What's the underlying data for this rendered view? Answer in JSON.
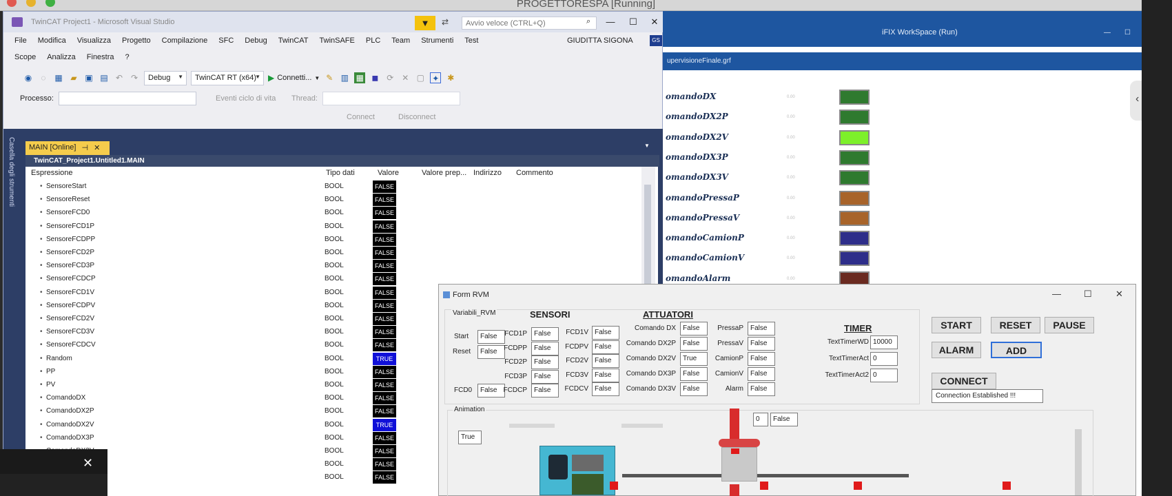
{
  "screen": {
    "title": "PROGETTORESPA [Running]"
  },
  "vs": {
    "title": "TwinCAT Project1 - Microsoft Visual Studio",
    "quick_launch_placeholder": "Avvio veloce (CTRL+Q)",
    "menu_row1": [
      "File",
      "Modifica",
      "Visualizza",
      "Progetto",
      "Compilazione",
      "SFC",
      "Debug",
      "TwinCAT",
      "TwinSAFE",
      "PLC",
      "Team",
      "Strumenti",
      "Test"
    ],
    "menu_row2": [
      "Scope",
      "Analizza",
      "Finestra",
      "?"
    ],
    "user_name": "GIUDITTA SIGONA",
    "user_badge": "GS",
    "toolbar": {
      "config": "Debug",
      "platform": "TwinCAT RT (x64)",
      "connect": "Connetti..."
    },
    "toolbar2": {
      "process_label": "Processo:",
      "events_label": "Eventi ciclo di vita",
      "thread_label": "Thread:"
    },
    "toolbar3": {
      "connect": "Connect",
      "disconnect": "Disconnect"
    },
    "left_strip_label": "Casella degli strumenti",
    "doc_tab": {
      "label": "MAIN [Online]",
      "close": "✕"
    },
    "doc_header": "TwinCAT_Project1.Untitled1.MAIN",
    "columns": {
      "expr": "Espressione",
      "type": "Tipo dati",
      "value": "Valore",
      "prep": "Valore prep...",
      "addr": "Indirizzo",
      "comment": "Commento"
    },
    "variables": [
      {
        "name": "SensoreStart",
        "type": "BOOL",
        "value": "FALSE"
      },
      {
        "name": "SensoreReset",
        "type": "BOOL",
        "value": "FALSE"
      },
      {
        "name": "SensoreFCD0",
        "type": "BOOL",
        "value": "FALSE"
      },
      {
        "name": "SensoreFCD1P",
        "type": "BOOL",
        "value": "FALSE"
      },
      {
        "name": "SensoreFCDPP",
        "type": "BOOL",
        "value": "FALSE"
      },
      {
        "name": "SensoreFCD2P",
        "type": "BOOL",
        "value": "FALSE"
      },
      {
        "name": "SensoreFCD3P",
        "type": "BOOL",
        "value": "FALSE"
      },
      {
        "name": "SensoreFCDCP",
        "type": "BOOL",
        "value": "FALSE"
      },
      {
        "name": "SensoreFCD1V",
        "type": "BOOL",
        "value": "FALSE"
      },
      {
        "name": "SensoreFCDPV",
        "type": "BOOL",
        "value": "FALSE"
      },
      {
        "name": "SensoreFCD2V",
        "type": "BOOL",
        "value": "FALSE"
      },
      {
        "name": "SensoreFCD3V",
        "type": "BOOL",
        "value": "FALSE"
      },
      {
        "name": "SensoreFCDCV",
        "type": "BOOL",
        "value": "FALSE"
      },
      {
        "name": "Random",
        "type": "BOOL",
        "value": "TRUE"
      },
      {
        "name": "PP",
        "type": "BOOL",
        "value": "FALSE"
      },
      {
        "name": "PV",
        "type": "BOOL",
        "value": "FALSE"
      },
      {
        "name": "ComandoDX",
        "type": "BOOL",
        "value": "FALSE"
      },
      {
        "name": "ComandoDX2P",
        "type": "BOOL",
        "value": "FALSE"
      },
      {
        "name": "ComandoDX2V",
        "type": "BOOL",
        "value": "TRUE"
      },
      {
        "name": "ComandoDX3P",
        "type": "BOOL",
        "value": "FALSE"
      },
      {
        "name": "ComandoDX3V",
        "type": "BOOL",
        "value": "FALSE"
      },
      {
        "name": "",
        "type": "BOOL",
        "value": "FALSE"
      },
      {
        "name": "",
        "type": "BOOL",
        "value": "FALSE"
      }
    ]
  },
  "ifix": {
    "title": "iFIX WorkSpace (Run)",
    "tab": "upervisioneFinale.grf",
    "commands": [
      {
        "name": "omandoDX",
        "value": "0.00",
        "color": "#2f7a2f"
      },
      {
        "name": "omandoDX2P",
        "value": "0.00",
        "color": "#2f7a2f"
      },
      {
        "name": "omandoDX2V",
        "value": "0.00",
        "color": "#7df02a"
      },
      {
        "name": "omandoDX3P",
        "value": "0.00",
        "color": "#2f7a2f"
      },
      {
        "name": "omandoDX3V",
        "value": "0.00",
        "color": "#2f7a2f"
      },
      {
        "name": "omandoPressaP",
        "value": "0.00",
        "color": "#a8642a"
      },
      {
        "name": "omandoPressaV",
        "value": "0.00",
        "color": "#a8642a"
      },
      {
        "name": "omandoCamionP",
        "value": "0.00",
        "color": "#2e2e8a"
      },
      {
        "name": "omandoCamionV",
        "value": "0.00",
        "color": "#2e2e8a"
      },
      {
        "name": "omandoAlarm",
        "value": "0.00",
        "color": "#6a2a20"
      }
    ]
  },
  "form": {
    "title": "Form RVM",
    "group_label": "Variabili_RVM",
    "sensori_title": "SENSORI",
    "attuatori_title": "ATTUATORI",
    "timer_title": "TIMER",
    "start_label": "Start",
    "start_val": "False",
    "reset_label": "Reset",
    "reset_val": "False",
    "fcd0_label": "FCD0",
    "fcd0_val": "False",
    "sensors_col1": [
      {
        "label": "FCD1P",
        "val": "False"
      },
      {
        "label": "FCDPP",
        "val": "False"
      },
      {
        "label": "FCD2P",
        "val": "False"
      },
      {
        "label": "FCD3P",
        "val": "False"
      },
      {
        "label": "FCDCP",
        "val": "False"
      }
    ],
    "sensors_col2": [
      {
        "label": "FCD1V",
        "val": "False"
      },
      {
        "label": "FCDPV",
        "val": "False"
      },
      {
        "label": "FCD2V",
        "val": "False"
      },
      {
        "label": "FCD3V",
        "val": "False"
      },
      {
        "label": "FCDCV",
        "val": "False"
      }
    ],
    "actuators_col1": [
      {
        "label": "Comando DX",
        "val": "False"
      },
      {
        "label": "Comando DX2P",
        "val": "False"
      },
      {
        "label": "Comando DX2V",
        "val": "True"
      },
      {
        "label": "Comando DX3P",
        "val": "False"
      },
      {
        "label": "Comando DX3V",
        "val": "False"
      }
    ],
    "actuators_col2": [
      {
        "label": "PressaP",
        "val": "False"
      },
      {
        "label": "PressaV",
        "val": "False"
      },
      {
        "label": "CamionP",
        "val": "False"
      },
      {
        "label": "CamionV",
        "val": "False"
      },
      {
        "label": "Alarm",
        "val": "False"
      }
    ],
    "timers": [
      {
        "label": "TextTimerWD",
        "val": "10000"
      },
      {
        "label": "TextTimerAct",
        "val": "0"
      },
      {
        "label": "TextTimerAct2",
        "val": "0"
      }
    ],
    "buttons": {
      "start": "START",
      "reset": "RESET",
      "pause": "PAUSE",
      "alarm": "ALARM",
      "add": "ADD",
      "connect": "CONNECT"
    },
    "connection_status": "Connection  Established !!!",
    "animation_label": "Animation",
    "anim_true": "True",
    "anim_counter": "0",
    "anim_false": "False"
  },
  "popup": {
    "close": "✕"
  }
}
